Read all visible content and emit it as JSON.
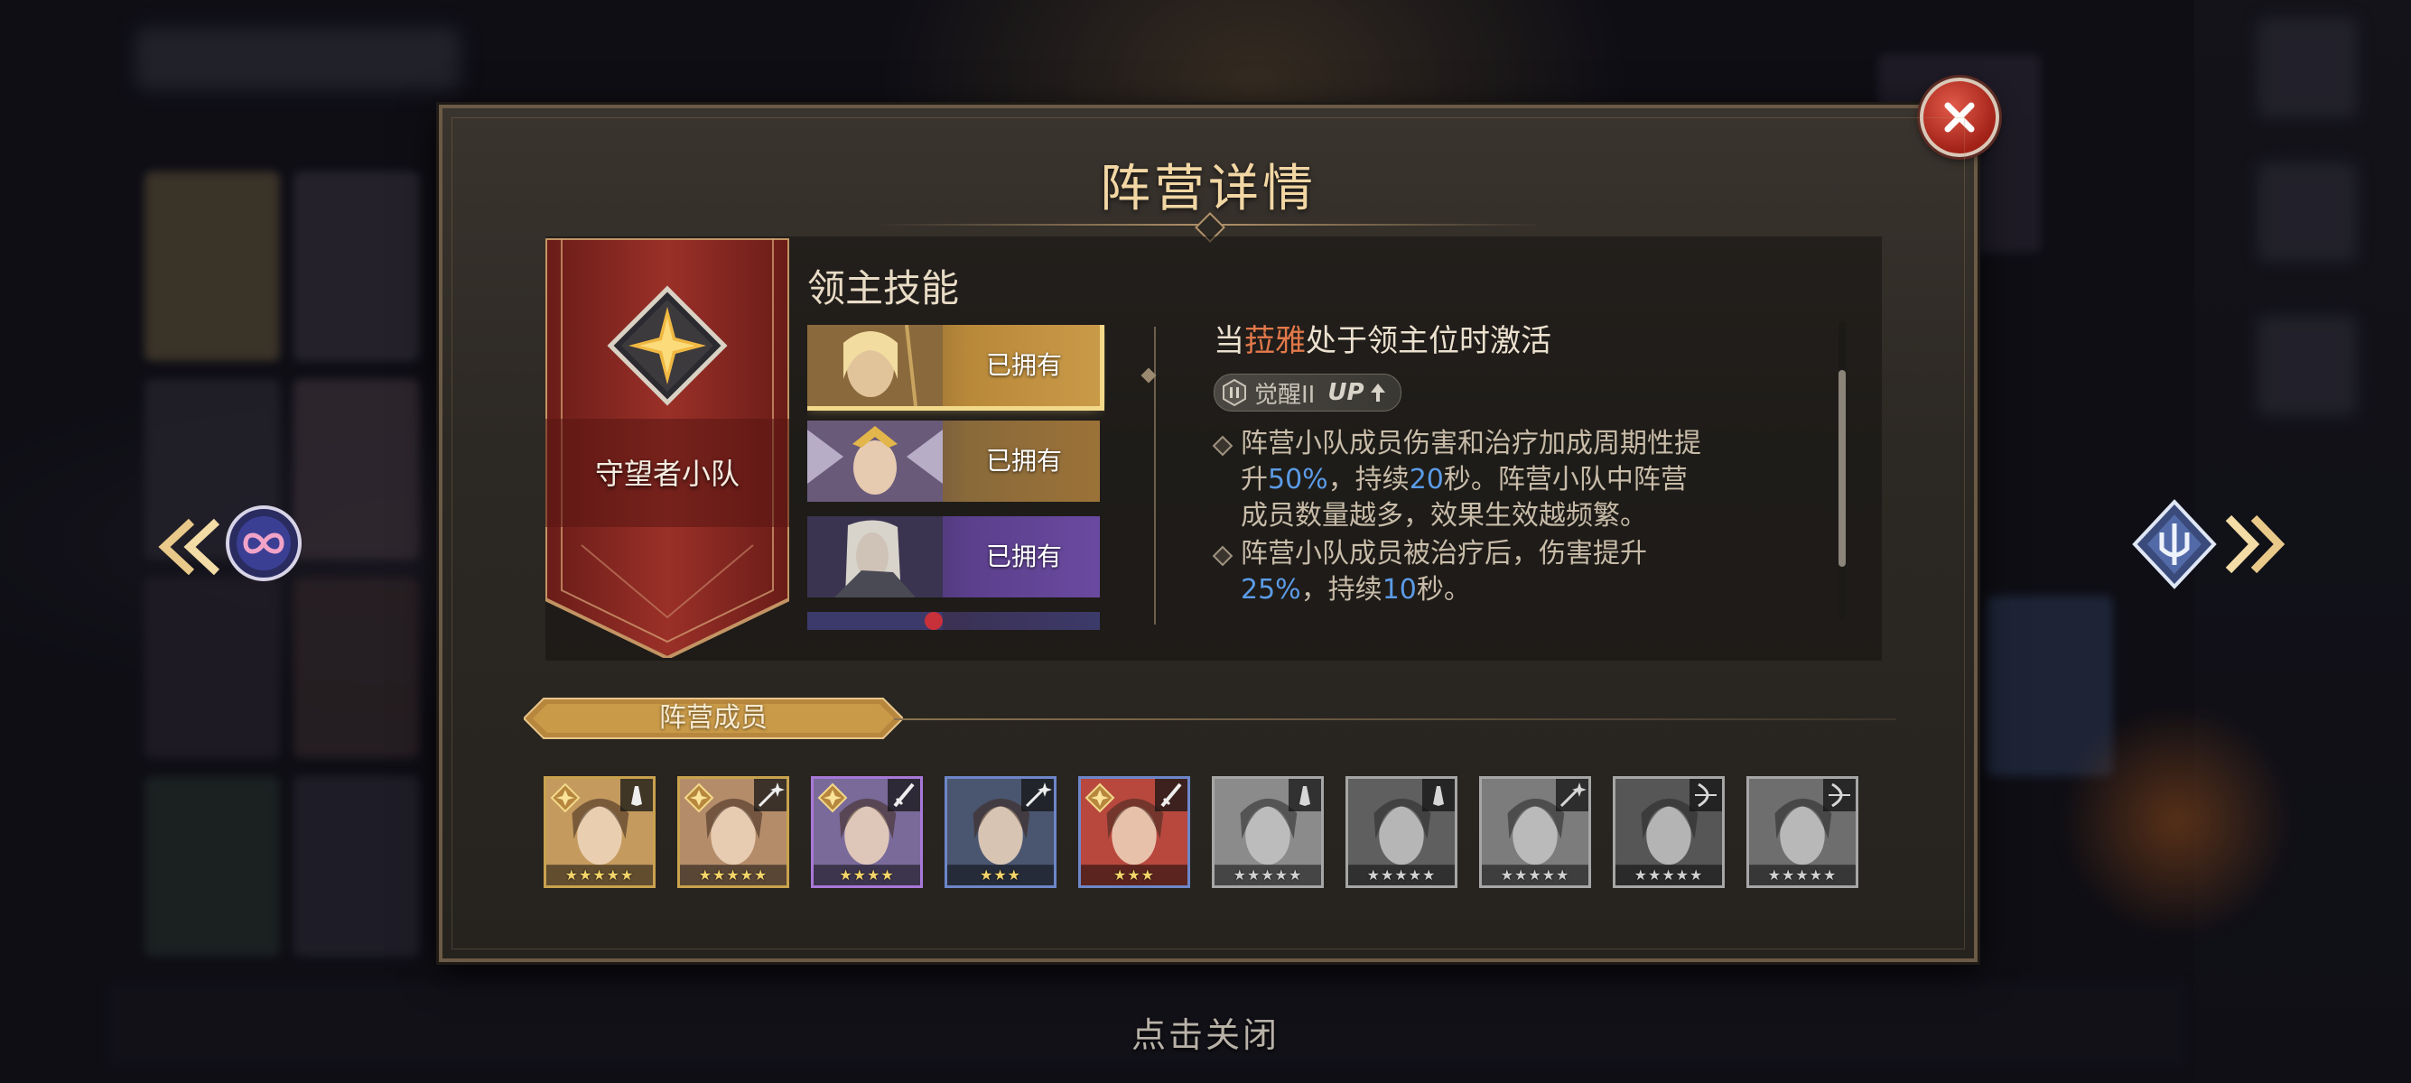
{
  "dialog": {
    "title": "阵营详情",
    "close_icon": "close-icon"
  },
  "faction": {
    "name": "守望者小队",
    "emblem_icon": "four-point-star-emblem-icon",
    "banner_color": "#8e2a24"
  },
  "lord_skill": {
    "title": "领主技能",
    "heroes": [
      {
        "status": "已拥有",
        "selected": true,
        "tint": "#b9893a"
      },
      {
        "status": "已拥有",
        "selected": false,
        "tint": "#8a6a3a"
      },
      {
        "status": "已拥有",
        "selected": false,
        "tint": "#5b3f8c"
      }
    ],
    "description": {
      "prefix": "当",
      "hero_name": "菈雅",
      "suffix": "处于领主位时激活",
      "awaken_label": "觉醒II",
      "up_label": "UP",
      "bullet1": {
        "part1": "阵营小队成员伤害和治疗加成周期性提升",
        "value1": "50%",
        "part2": "，持续",
        "value2": "20",
        "part3": "秒。阵营小队中阵营成员数量越多，效果生效越频繁。"
      },
      "bullet2": {
        "part1": "阵营小队成员被治疗后，伤害提升",
        "value1": "25%",
        "part2": "，持续",
        "value2": "10",
        "part3": "秒。"
      }
    }
  },
  "members": {
    "title": "阵营成员",
    "list": [
      {
        "rarity": "gold",
        "stars": "★★★★★",
        "class_icon": "praying-hands-icon",
        "badge": true,
        "tint": "#c49a5e"
      },
      {
        "rarity": "gold",
        "stars": "★★★★★",
        "class_icon": "magic-wand-icon",
        "badge": true,
        "tint": "#b58c6a"
      },
      {
        "rarity": "purple",
        "stars": "★★★★",
        "class_icon": "sword-icon",
        "badge": true,
        "tint": "#7a6a9a"
      },
      {
        "rarity": "blue",
        "stars": "★★★",
        "class_icon": "magic-wand-icon",
        "badge": false,
        "tint": "#4a5670"
      },
      {
        "rarity": "blue",
        "stars": "★★★",
        "class_icon": "sword-icon",
        "badge": true,
        "tint": "#b8483e"
      },
      {
        "rarity": "gray",
        "stars": "★★★★★",
        "class_icon": "praying-hands-icon",
        "badge": false,
        "tint": "#9a9a9a"
      },
      {
        "rarity": "gray",
        "stars": "★★★★★",
        "class_icon": "praying-hands-icon",
        "badge": false,
        "tint": "#6a6a6a"
      },
      {
        "rarity": "gray",
        "stars": "★★★★★",
        "class_icon": "magic-wand-icon",
        "badge": false,
        "tint": "#8a8a8a"
      },
      {
        "rarity": "gray",
        "stars": "★★★★★",
        "class_icon": "bow-icon",
        "badge": false,
        "tint": "#5f5f5f"
      },
      {
        "rarity": "gray",
        "stars": "★★★★★",
        "class_icon": "bow-icon",
        "badge": false,
        "tint": "#7a7a7a"
      }
    ]
  },
  "navigation": {
    "prev_icon": "double-chevron-left-icon",
    "prev_faction_icon": "infinity-faction-icon",
    "next_icon": "double-chevron-right-icon",
    "next_faction_icon": "trident-faction-icon"
  },
  "footer": {
    "tap_to_close": "点击关闭"
  }
}
